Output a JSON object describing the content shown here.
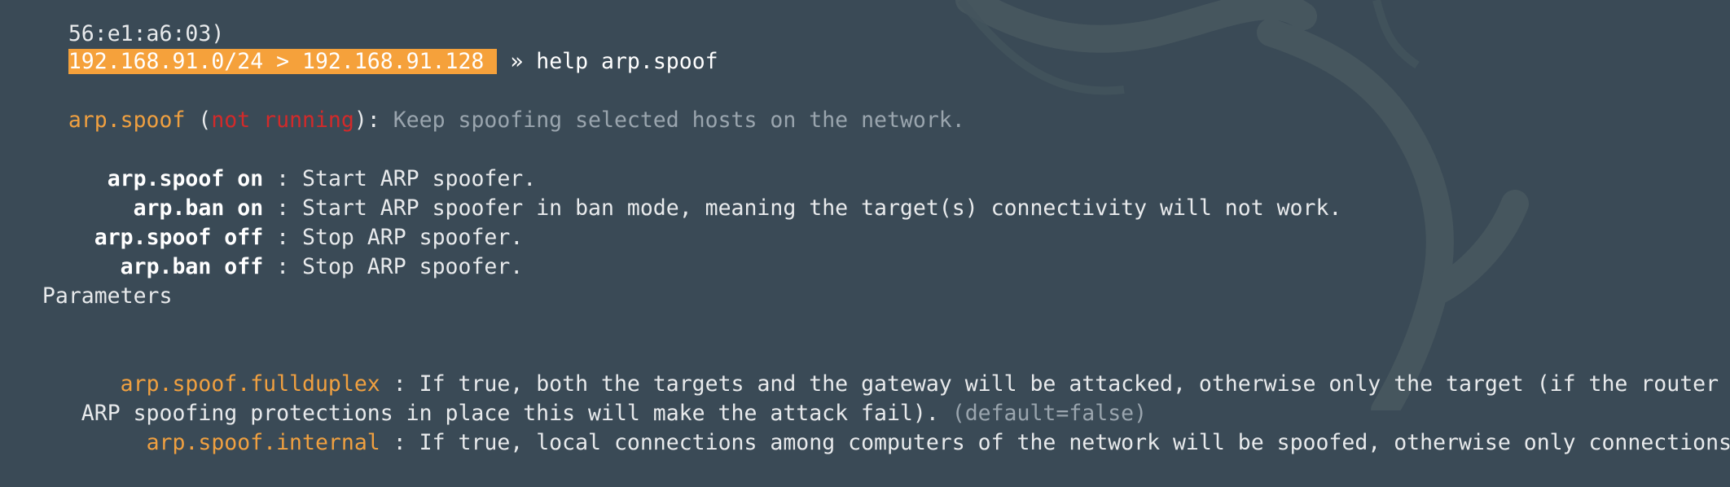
{
  "terminal": {
    "top_fragment": "56:e1:a6:03)",
    "prompt": {
      "label": "192.168.91.0/24 > 192.168.91.128",
      "separator": " » ",
      "command": "help arp.spoof"
    },
    "module_header": {
      "name": "arp.spoof",
      "open_paren": " (",
      "status": "not running",
      "close_paren": "): ",
      "description": "Keep spoofing selected hosts on the network."
    },
    "commands": [
      {
        "indent": "   ",
        "name": "arp.spoof on",
        "sep": " : ",
        "desc": "Start ARP spoofer."
      },
      {
        "indent": "     ",
        "name": "arp.ban on",
        "sep": " : ",
        "desc": "Start ARP spoofer in ban mode, meaning the target(s) connectivity will not work."
      },
      {
        "indent": "  ",
        "name": "arp.spoof off",
        "sep": " : ",
        "desc": "Stop ARP spoofer."
      },
      {
        "indent": "    ",
        "name": "arp.ban off",
        "sep": " : ",
        "desc": "Stop ARP spoofer."
      }
    ],
    "parameters_heading": "  Parameters",
    "parameters": [
      {
        "indent": "    ",
        "name": "arp.spoof.fullduplex",
        "sep": " : ",
        "desc_line1": "If true, both the targets and the gateway will be attacked, otherwise only the target (if the router has",
        "desc_line2": " ARP spoofing protections in place this will make the attack fail).",
        "default": " (default=false)"
      },
      {
        "indent": "      ",
        "name": "arp.spoof.internal",
        "sep": " : ",
        "desc_line1": "If true, local connections among computers of the network will be spoofed, otherwise only connections go"
      }
    ]
  },
  "colors": {
    "background": "#3a4a56",
    "prompt_bg": "#f5a13b",
    "module": "#f0a040",
    "status_red": "#d22a2a",
    "dim": "#9aa5ae"
  }
}
